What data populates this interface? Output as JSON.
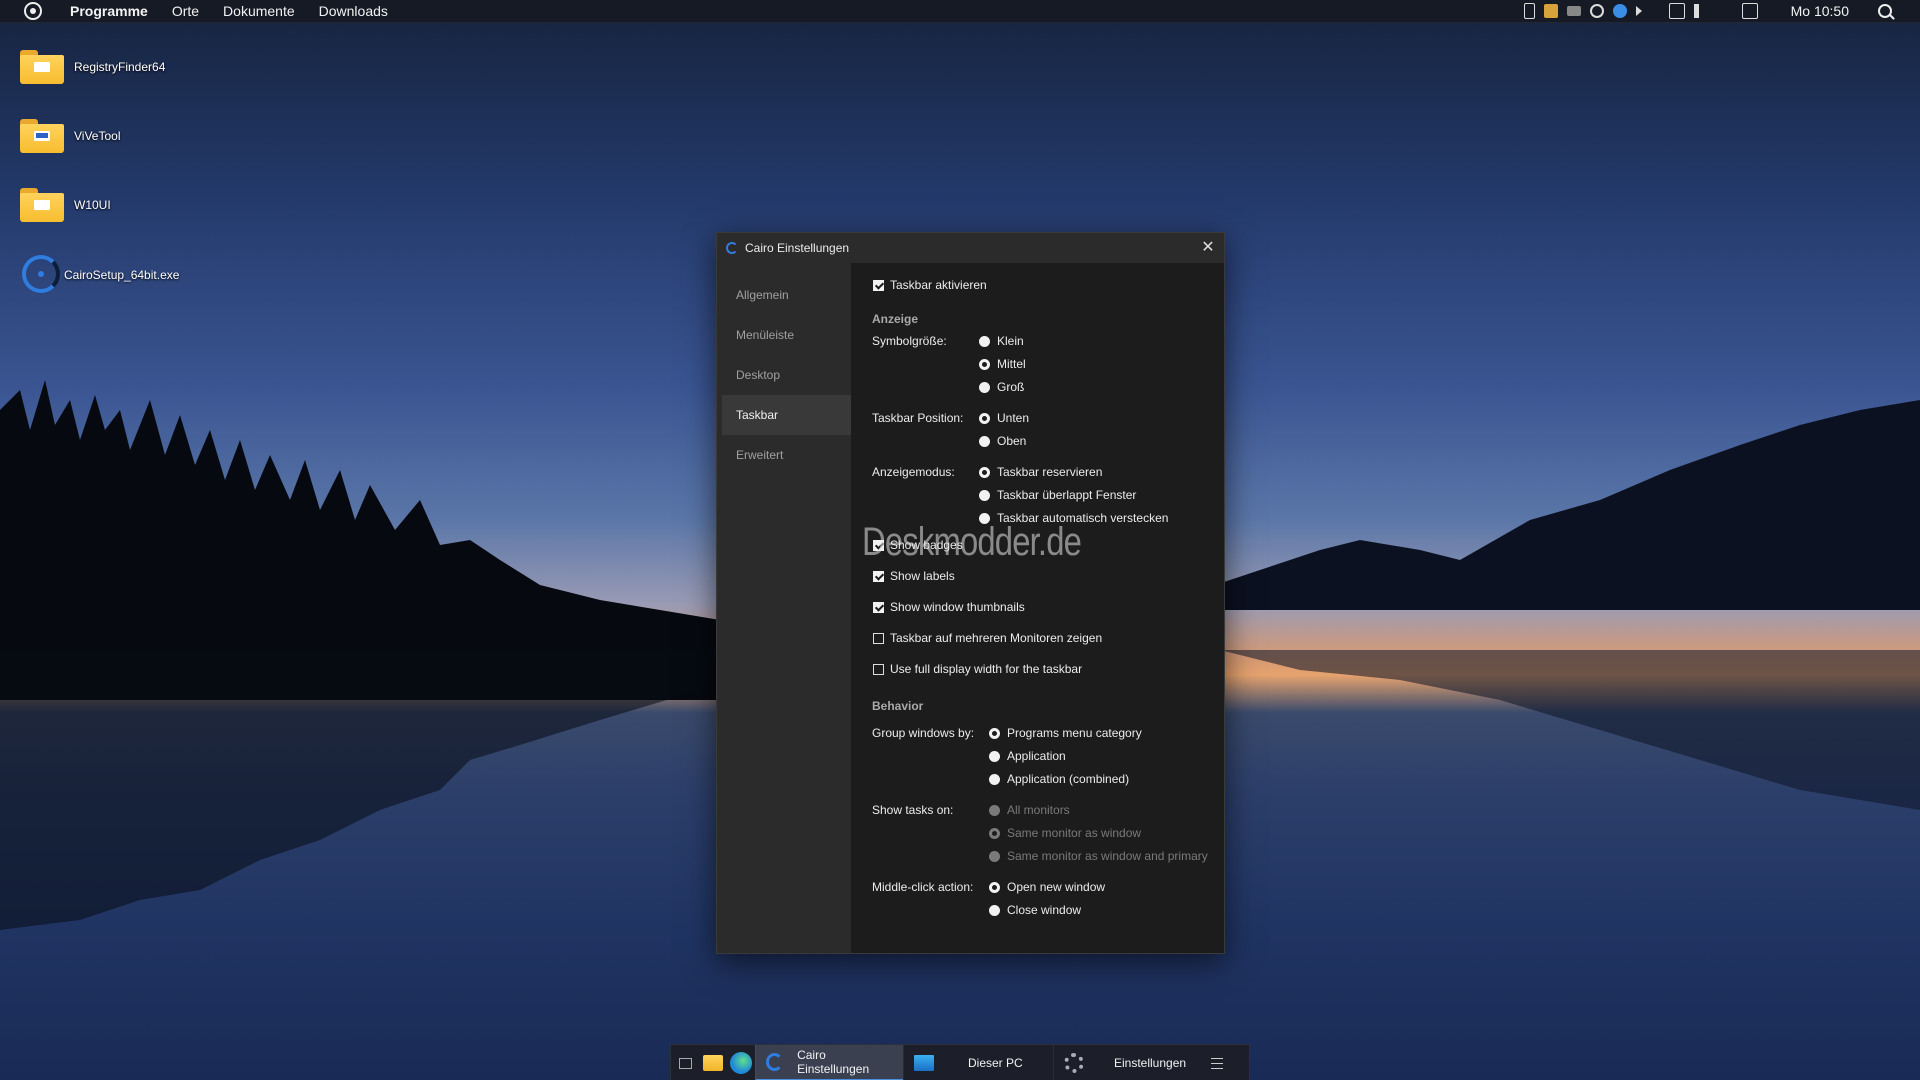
{
  "menubar": {
    "items": [
      "Programme",
      "Orte",
      "Dokumente",
      "Downloads"
    ],
    "clock": "Mo 10:50"
  },
  "desktop": {
    "icons": [
      {
        "label": "RegistryFinder64",
        "icon": "folder-icon"
      },
      {
        "label": "ViVeTool",
        "icon": "folder-icon"
      },
      {
        "label": "W10UI",
        "icon": "folder-icon"
      },
      {
        "label": "CairoSetup_64bit.exe",
        "icon": "cairo-setup-icon"
      }
    ]
  },
  "window": {
    "title": "Cairo Einstellungen",
    "nav": [
      "Allgemein",
      "Menüleiste",
      "Desktop",
      "Taskbar",
      "Erweitert"
    ],
    "active_nav": "Taskbar",
    "enable_taskbar": {
      "label": "Taskbar aktivieren",
      "checked": true
    },
    "section_display": "Anzeige",
    "icon_size": {
      "label": "Symbolgröße:",
      "options": [
        "Klein",
        "Mittel",
        "Groß"
      ],
      "selected": "Mittel"
    },
    "position": {
      "label": "Taskbar Position:",
      "options": [
        "Unten",
        "Oben"
      ],
      "selected": "Unten"
    },
    "mode": {
      "label": "Anzeigemodus:",
      "options": [
        "Taskbar reservieren",
        "Taskbar überlappt Fenster",
        "Taskbar automatisch verstecken"
      ],
      "selected": "Taskbar reservieren"
    },
    "checkboxes": [
      {
        "label": "Show badges",
        "checked": true
      },
      {
        "label": "Show labels",
        "checked": true
      },
      {
        "label": "Show window thumbnails",
        "checked": true
      },
      {
        "label": "Taskbar auf mehreren Monitoren zeigen",
        "checked": false
      },
      {
        "label": "Use full display width for the taskbar",
        "checked": false
      }
    ],
    "section_behavior": "Behavior",
    "group_by": {
      "label": "Group windows by:",
      "options": [
        "Programs menu category",
        "Application",
        "Application (combined)"
      ],
      "selected": "Programs menu category"
    },
    "show_tasks": {
      "label": "Show tasks on:",
      "options": [
        "All monitors",
        "Same monitor as window",
        "Same monitor as window and primary"
      ],
      "selected": "Same monitor as window",
      "disabled": true
    },
    "middle_click": {
      "label": "Middle-click action:",
      "options": [
        "Open new window",
        "Close window"
      ],
      "selected": "Open new window"
    }
  },
  "watermark": "Deskmodder.de",
  "taskbar": {
    "tasks": [
      {
        "label": "Cairo Einstellungen",
        "active": true
      },
      {
        "label": "Dieser PC",
        "active": false
      },
      {
        "label": "Einstellungen",
        "active": false
      }
    ]
  },
  "colors": {
    "accent": "#4a90e2",
    "window_bg": "#1c1c1c",
    "sidebar_bg": "#2b2b2b"
  }
}
